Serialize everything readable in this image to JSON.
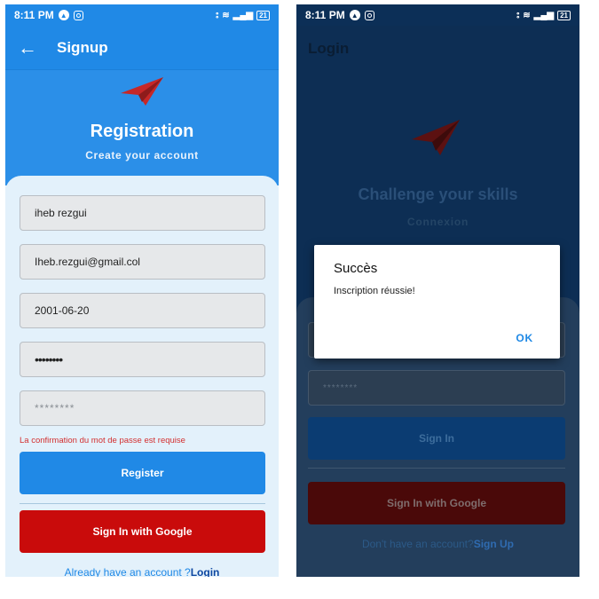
{
  "colors": {
    "primary": "#2089e6",
    "google_red": "#c90b0b",
    "error": "#d32f2f",
    "plane": "#c62828"
  },
  "status_bar": {
    "time": "8:11 PM",
    "battery": "21"
  },
  "signup": {
    "appbar_title": "Signup",
    "hero_title": "Registration",
    "hero_subtitle": "Create your account",
    "fields": {
      "name": "iheb rezgui",
      "email": "Iheb.rezgui@gmail.col",
      "birthdate": "2001-06-20",
      "password": "••••••••",
      "confirm_placeholder": "********"
    },
    "error_message": "La confirmation du mot de passe est requise",
    "register_label": "Register",
    "google_label": "Sign In with Google",
    "footer_text": "Already have an account ?",
    "footer_link": "Login"
  },
  "login": {
    "appbar_title": "Login",
    "title": "Challenge your skills",
    "subtitle": "Connexion",
    "password_placeholder": "********",
    "signin_label": "Sign In",
    "google_label": "Sign In with Google",
    "footer_text": "Don't have an account?",
    "footer_link": "Sign Up"
  },
  "dialog": {
    "title": "Succès",
    "message": "Inscription réussie!",
    "ok_label": "OK"
  }
}
